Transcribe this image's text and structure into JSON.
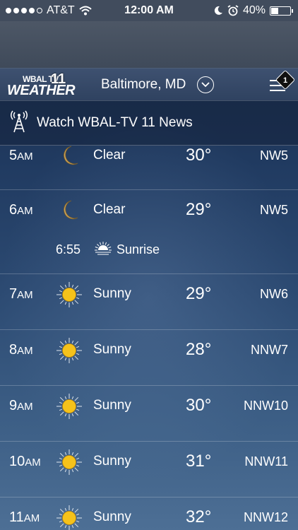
{
  "status_bar": {
    "carrier": "AT&T",
    "time": "12:00 AM",
    "battery": "40%",
    "battery_level": 0.4,
    "signal_bars": 4,
    "icons": [
      "wifi-icon",
      "moon-icon",
      "alarm-icon",
      "battery-icon"
    ]
  },
  "header": {
    "logo_top": "WBAL TV",
    "logo_number": "11",
    "logo_bottom": "WEATHER",
    "location": "Baltimore, MD",
    "menu_badge": "1"
  },
  "watch": {
    "label": "Watch WBAL-TV 11 News"
  },
  "hours": [
    {
      "hour": "5",
      "suffix": "AM",
      "icon": "moon-icon",
      "condition": "Clear",
      "temp": "30°",
      "wind": "NW5"
    },
    {
      "hour": "6",
      "suffix": "AM",
      "icon": "moon-icon",
      "condition": "Clear",
      "temp": "29°",
      "wind": "NW5"
    },
    {
      "hour": "7",
      "suffix": "AM",
      "icon": "sun-icon",
      "condition": "Sunny",
      "temp": "29°",
      "wind": "NW6"
    },
    {
      "hour": "8",
      "suffix": "AM",
      "icon": "sun-icon",
      "condition": "Sunny",
      "temp": "28°",
      "wind": "NNW7"
    },
    {
      "hour": "9",
      "suffix": "AM",
      "icon": "sun-icon",
      "condition": "Sunny",
      "temp": "30°",
      "wind": "NNW10"
    },
    {
      "hour": "10",
      "suffix": "AM",
      "icon": "sun-icon",
      "condition": "Sunny",
      "temp": "31°",
      "wind": "NNW11"
    },
    {
      "hour": "11",
      "suffix": "AM",
      "icon": "sun-icon",
      "condition": "Sunny",
      "temp": "32°",
      "wind": "NNW12"
    }
  ],
  "sunrise": {
    "time": "6:55",
    "label": "Sunrise"
  },
  "colors": {
    "sun": "#f5c21b",
    "moon": "#c8a25a"
  }
}
